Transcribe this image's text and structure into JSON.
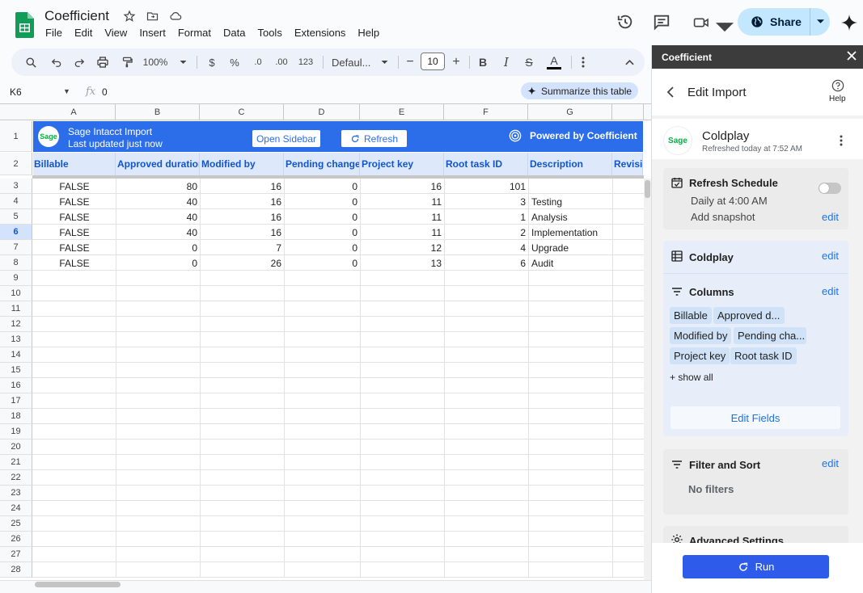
{
  "app": {
    "doc_title": "Coefficient",
    "menu": [
      "File",
      "Edit",
      "View",
      "Insert",
      "Format",
      "Data",
      "Tools",
      "Extensions",
      "Help"
    ],
    "share_label": "Share"
  },
  "toolbar": {
    "zoom": "100%",
    "currency": "$",
    "percent": "%",
    "dec_less": ".0",
    "dec_more": ".00",
    "number_fmt": "123",
    "font": "Defaul...",
    "font_size": "10",
    "bold": "B",
    "italic": "I",
    "strike": "S",
    "text_color": "A"
  },
  "formula_bar": {
    "cell_ref": "K6",
    "fx": "fx",
    "value": "0",
    "summarize": "Summarize this table"
  },
  "sheet": {
    "columns": [
      "A",
      "B",
      "C",
      "D",
      "E",
      "F",
      "G"
    ],
    "rows": [
      "1",
      "2",
      "3",
      "4",
      "5",
      "6",
      "7",
      "8",
      "9",
      "10",
      "11",
      "12",
      "13",
      "14",
      "15",
      "16",
      "17",
      "18",
      "19",
      "20",
      "21",
      "22",
      "23",
      "24",
      "25",
      "26",
      "27",
      "28"
    ],
    "selected_row": "6",
    "banner": {
      "title": "Sage Intacct Import",
      "subtitle": "Last updated just now",
      "open_sidebar": "Open Sidebar",
      "refresh": "Refresh",
      "powered_by": "Powered by Coefficient",
      "logo_text": "Sage"
    },
    "headers": [
      "Billable",
      "Approved duration",
      "Modified by",
      "Pending change",
      "Project key",
      "Root task ID",
      "Description",
      "Revisio"
    ],
    "data": [
      [
        "FALSE",
        "80",
        "16",
        "0",
        "16",
        "101",
        ""
      ],
      [
        "FALSE",
        "40",
        "16",
        "0",
        "11",
        "3",
        "Testing"
      ],
      [
        "FALSE",
        "40",
        "16",
        "0",
        "11",
        "1",
        "Analysis"
      ],
      [
        "FALSE",
        "40",
        "16",
        "0",
        "11",
        "2",
        "Implementation"
      ],
      [
        "FALSE",
        "0",
        "7",
        "0",
        "12",
        "4",
        "Upgrade"
      ],
      [
        "FALSE",
        "0",
        "26",
        "0",
        "13",
        "6",
        "Audit"
      ]
    ]
  },
  "panel": {
    "header": "Coefficient",
    "title": "Edit Import",
    "help": "Help",
    "source": {
      "name": "Coldplay",
      "refreshed": "Refreshed today at 7:52 AM",
      "logo_text": "Sage"
    },
    "refresh_schedule": {
      "title": "Refresh Schedule",
      "schedule": "Daily at 4:00 AM",
      "snapshot": "Add snapshot",
      "edit": "edit"
    },
    "table": {
      "title": "Coldplay",
      "edit": "edit"
    },
    "columns": {
      "title": "Columns",
      "edit": "edit",
      "chips": [
        "Billable",
        "Approved d...",
        "Modified by",
        "Pending cha...",
        "Project key",
        "Root task ID"
      ],
      "show_all": "+ show all",
      "edit_fields": "Edit Fields"
    },
    "filter": {
      "title": "Filter and Sort",
      "edit": "edit",
      "none": "No filters"
    },
    "advanced": {
      "title": "Advanced Settings"
    },
    "run": "Run"
  },
  "colors": {
    "banner": "#2c6eea",
    "header_text": "#1155cc",
    "run_button": "#2f5bea",
    "share_bg": "#c2e7ff"
  }
}
